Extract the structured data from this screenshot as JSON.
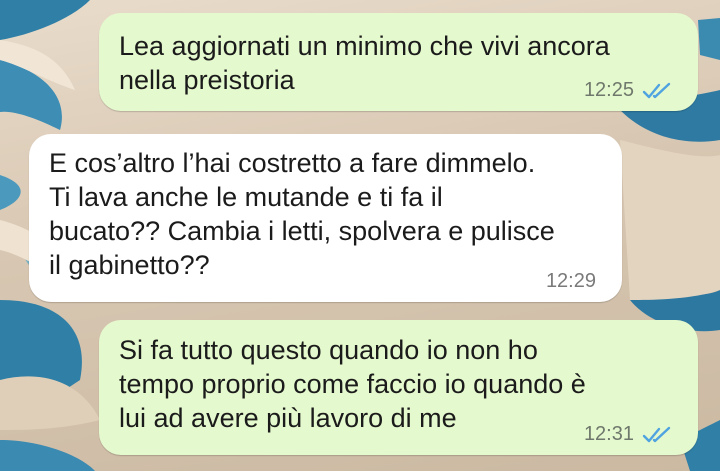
{
  "chat": {
    "wallpaper": "sand-dunes-lagoons",
    "colors": {
      "outgoing_bubble": "#e5f9ce",
      "incoming_bubble": "#ffffff",
      "read_ticks": "#4fa3e0"
    },
    "messages": [
      {
        "direction": "outgoing",
        "text": "Lea aggiornati un minimo che vivi ancora\nnella preistoria",
        "time": "12:25",
        "status": "read",
        "status_icon": "double-check-icon"
      },
      {
        "direction": "incoming",
        "text": "E cos’altro l’hai costretto a fare dimmelo.\nTi lava anche le mutande e ti fa il\nbucato?? Cambia i letti, spolvera e pulisce\nil gabinetto??",
        "time": "12:29"
      },
      {
        "direction": "outgoing",
        "text": "Si fa tutto questo quando io non ho\ntempo proprio come faccio io quando è\nlui ad avere più lavoro di me",
        "time": "12:31",
        "status": "read",
        "status_icon": "double-check-icon"
      }
    ]
  }
}
